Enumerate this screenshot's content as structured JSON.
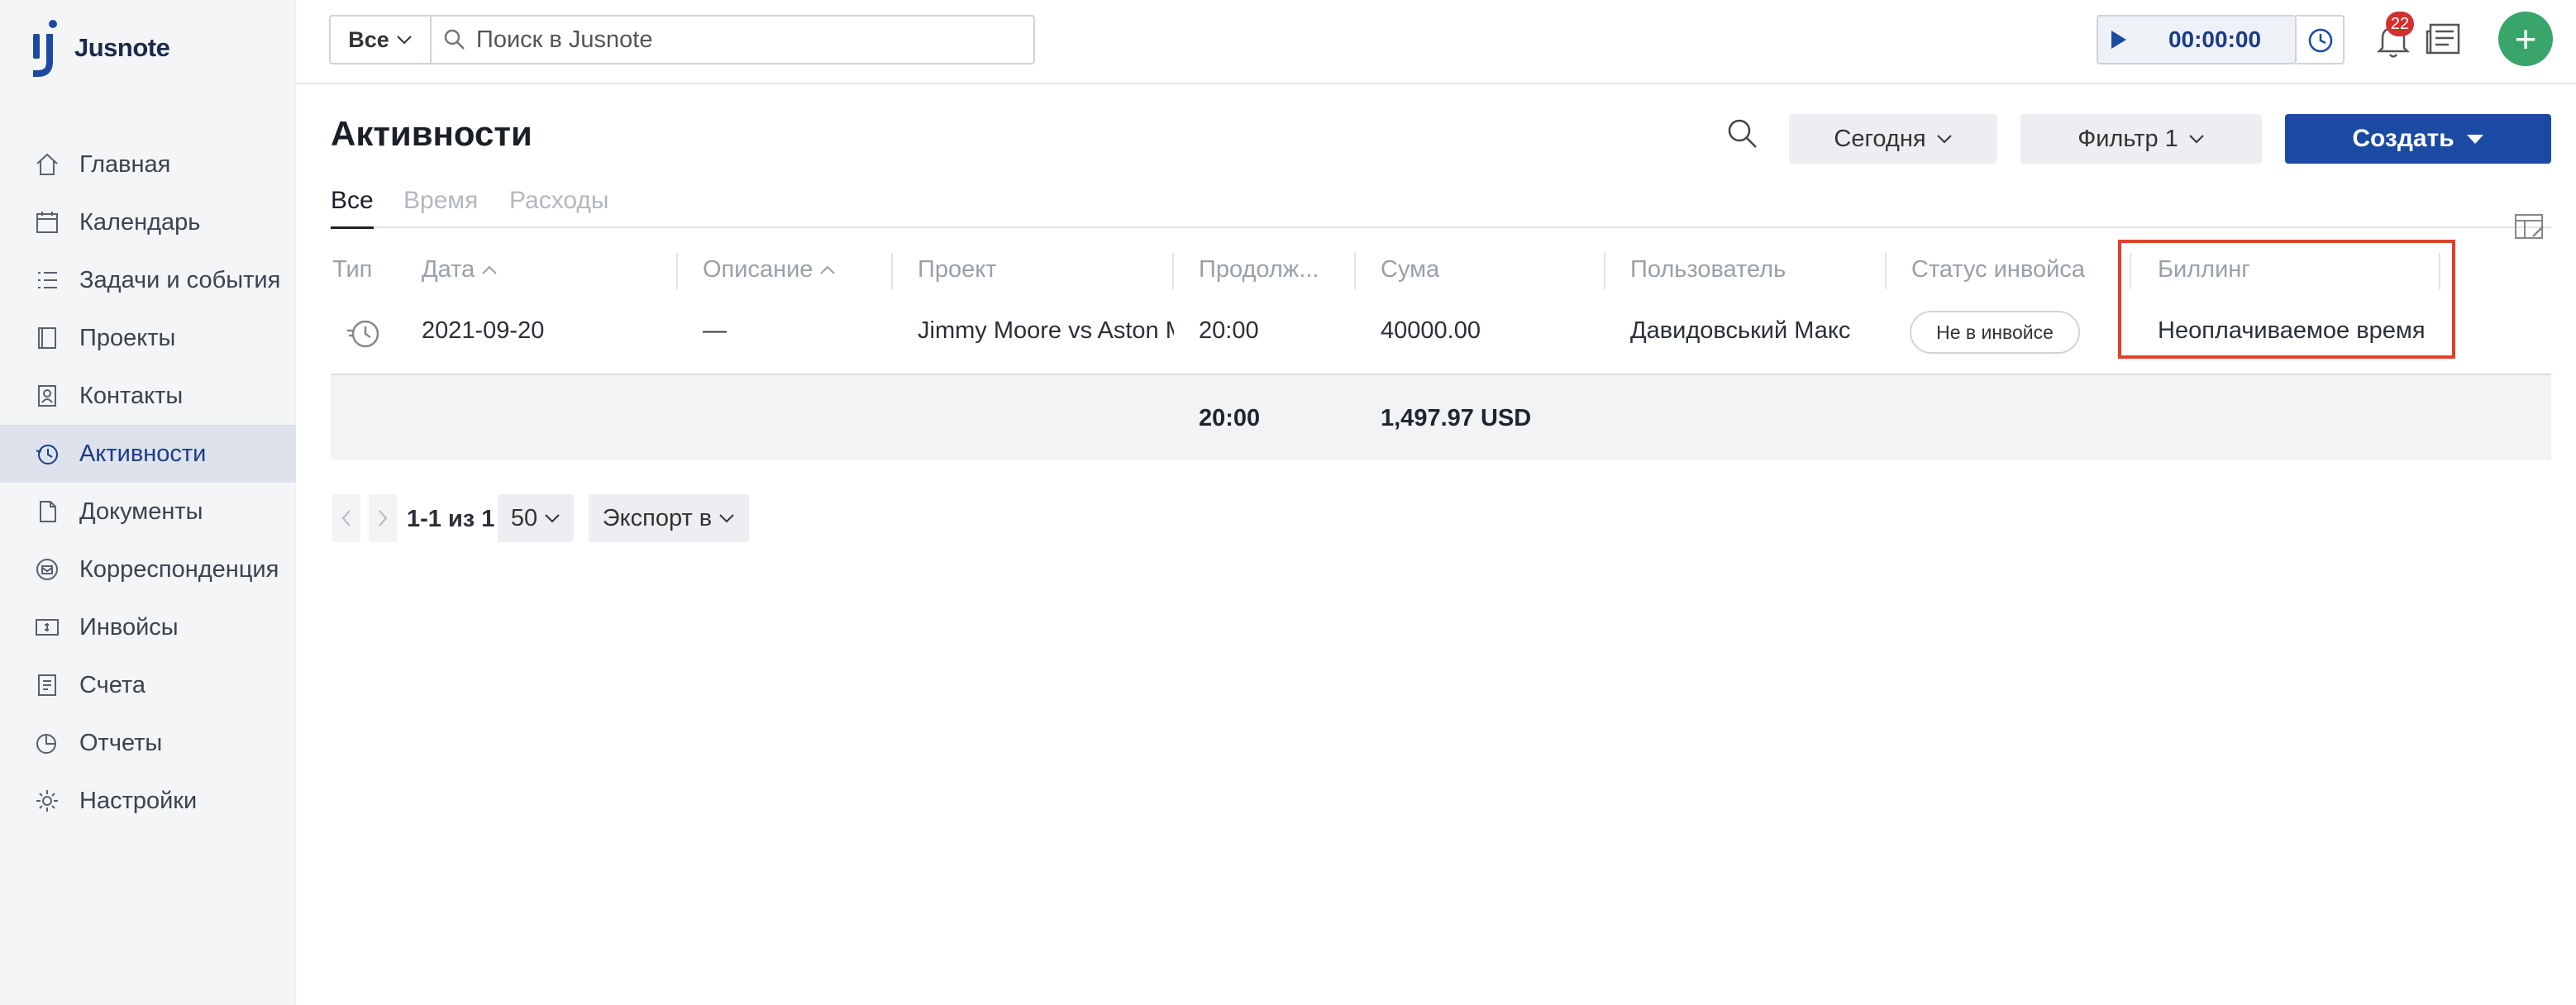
{
  "brand": {
    "name": "Jusnote"
  },
  "sidebar": {
    "items": [
      {
        "label": "Главная",
        "icon": "home-icon"
      },
      {
        "label": "Календарь",
        "icon": "calendar-icon"
      },
      {
        "label": "Задачи и события",
        "icon": "tasks-icon"
      },
      {
        "label": "Проекты",
        "icon": "projects-icon"
      },
      {
        "label": "Контакты",
        "icon": "contacts-icon"
      },
      {
        "label": "Активности",
        "icon": "activities-icon",
        "active": true
      },
      {
        "label": "Документы",
        "icon": "documents-icon"
      },
      {
        "label": "Корреспонденция",
        "icon": "correspondence-icon"
      },
      {
        "label": "Инвойсы",
        "icon": "invoices-icon"
      },
      {
        "label": "Счета",
        "icon": "accounts-icon"
      },
      {
        "label": "Отчеты",
        "icon": "reports-icon"
      },
      {
        "label": "Настройки",
        "icon": "settings-icon"
      }
    ]
  },
  "topbar": {
    "scope": "Все",
    "search_placeholder": "Поиск в Jusnote",
    "timer": "00:00:00",
    "notifications": "22"
  },
  "page": {
    "title": "Активности",
    "today": "Сегодня",
    "filter": "Фильтр 1",
    "create": "Создать",
    "tabs": [
      "Все",
      "Время",
      "Расходы"
    ]
  },
  "table": {
    "headers": {
      "type": "Тип",
      "date": "Дата",
      "description": "Описание",
      "project": "Проект",
      "duration": "Продолж...",
      "sum": "Сума",
      "user": "Пользователь",
      "invoice_status": "Статус инвойса",
      "billing": "Биллинг"
    },
    "row": {
      "date": "2021-09-20",
      "description": "—",
      "project": "Jimmy Moore vs Aston Martin",
      "duration": "20:00",
      "sum": "40000.00",
      "user": "Давидовський Макс",
      "invoice_status": "Не в инвойсе",
      "billing": "Неоплачиваемое время"
    },
    "totals": {
      "duration": "20:00",
      "sum": "1,497.97 USD"
    }
  },
  "pager": {
    "range": "1-1 из 1",
    "page_size": "50",
    "export": "Экспорт в"
  },
  "colors": {
    "accent": "#1b4aa3",
    "fab": "#3aa56b",
    "highlight": "#e0412c",
    "badge": "#d32f2f"
  }
}
